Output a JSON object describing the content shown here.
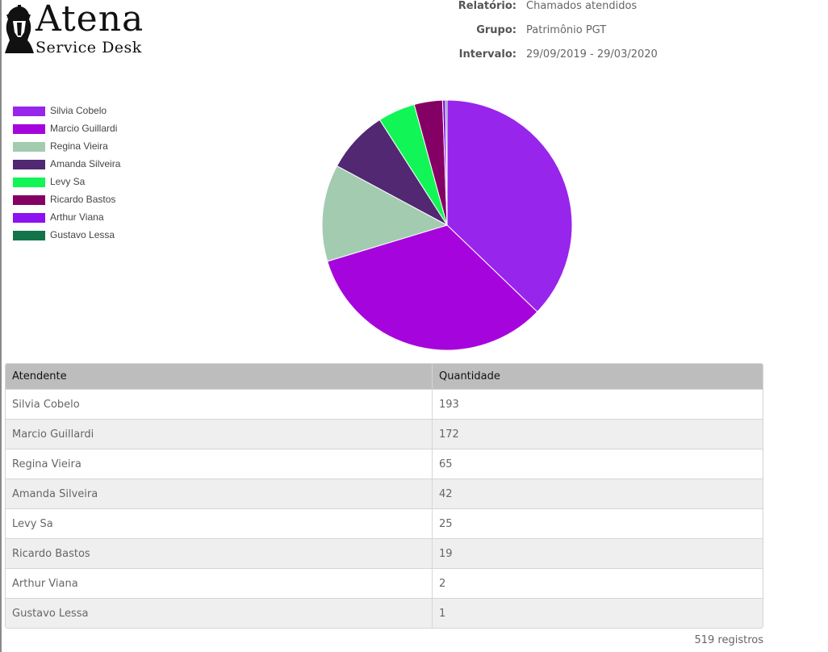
{
  "logo": {
    "name": "Atena",
    "subtitle": "Service Desk"
  },
  "report": {
    "rows": [
      {
        "label": "Relatório:",
        "value": "Chamados atendidos"
      },
      {
        "label": "Grupo:",
        "value": "Patrimônio PGT"
      },
      {
        "label": "Intervalo:",
        "value": "29/09/2019 - 29/03/2020"
      }
    ]
  },
  "chart_data": {
    "type": "pie",
    "categories": [
      "Silvia Cobelo",
      "Marcio Guillardi",
      "Regina Vieira",
      "Amanda Silveira",
      "Levy Sa",
      "Ricardo Bastos",
      "Arthur Viana",
      "Gustavo Lessa"
    ],
    "values": [
      193,
      172,
      65,
      42,
      25,
      19,
      2,
      1
    ],
    "colors": [
      "#9825ec",
      "#a604dd",
      "#a3cbb0",
      "#512871",
      "#12f556",
      "#850065",
      "#8d12ef",
      "#137349"
    ],
    "legend_position": "left"
  },
  "table": {
    "headers": [
      "Atendente",
      "Quantidade"
    ],
    "rows": [
      [
        "Silvia Cobelo",
        "193"
      ],
      [
        "Marcio Guillardi",
        "172"
      ],
      [
        "Regina Vieira",
        "65"
      ],
      [
        "Amanda Silveira",
        "42"
      ],
      [
        "Levy Sa",
        "25"
      ],
      [
        "Ricardo Bastos",
        "19"
      ],
      [
        "Arthur Viana",
        "2"
      ],
      [
        "Gustavo Lessa",
        "1"
      ]
    ]
  },
  "footer": {
    "count": "519 registros"
  }
}
